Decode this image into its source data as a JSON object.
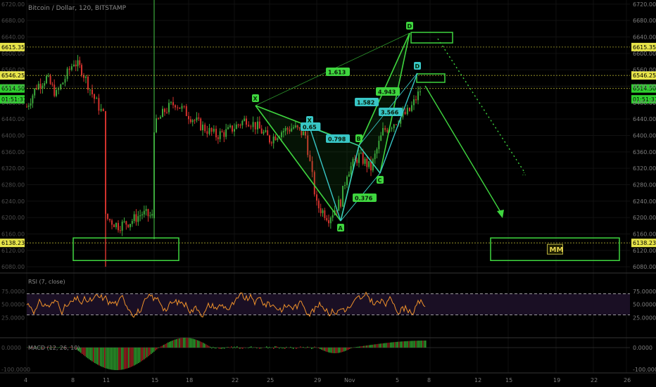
{
  "header": {
    "title": "Bitcoin / Dollar, 120, BITSTAMP"
  },
  "colors": {
    "background": "#000000",
    "up_candle": "#3ca83c",
    "down_candle": "#d2322d",
    "pattern_green": "#3fd63f",
    "pattern_cyan": "#38c6c6",
    "level_line": "#d4cf3a",
    "rsi_line": "#f0922b",
    "rsi_band": "#1a0f24",
    "price_marker_yellow": "#e8e54a",
    "price_marker_green": "#2fd02f"
  },
  "price_axis": {
    "ticks": [
      "6720.00",
      "6680.00",
      "6640.00",
      "6600.00",
      "6560.00",
      "6520.00",
      "6480.00",
      "6440.00",
      "6400.00",
      "6360.00",
      "6320.00",
      "6280.00",
      "6240.00",
      "6200.00",
      "6160.00",
      "6120.00",
      "6080.00"
    ],
    "price_markers_left": [
      {
        "text": "6615.35",
        "price": 6615.35,
        "color": "yellow"
      },
      {
        "text": "6546.25",
        "price": 6546.25,
        "color": "yellow"
      },
      {
        "text": "6514.50",
        "price": 6514.5,
        "color": "green"
      },
      {
        "text": "01:51:37",
        "price": 6488,
        "color": "green"
      },
      {
        "text": "6138.23",
        "price": 6138.23,
        "color": "yellow"
      }
    ],
    "price_markers_right": [
      {
        "text": "6615.35",
        "price": 6615.35,
        "color": "yellow"
      },
      {
        "text": "6546.25",
        "price": 6546.25,
        "color": "yellow"
      },
      {
        "text": "6514.50",
        "price": 6514.5,
        "color": "green"
      },
      {
        "text": "01:51:37",
        "price": 6488,
        "color": "green"
      },
      {
        "text": "6138.23",
        "price": 6138.23,
        "color": "yellow"
      }
    ]
  },
  "time_axis": {
    "ticks": [
      "4",
      "8",
      "11",
      "15",
      "18",
      "22",
      "25",
      "29",
      "Nov",
      "5",
      "8",
      "12",
      "15",
      "19",
      "22",
      "26"
    ]
  },
  "rsi": {
    "label": "RSI (7, close)",
    "ticks": [
      "75.0000",
      "50.0000",
      "25.0000"
    ],
    "upper": 70,
    "lower": 30
  },
  "macd": {
    "label": "MACD (12, 26, 10)",
    "ticks": [
      "0.0000",
      "-100.0000"
    ]
  },
  "chart_data": {
    "type": "candlestick",
    "title": "Bitcoin / Dollar, 120, BITSTAMP",
    "ylim": [
      6070,
      6730
    ],
    "horizontal_levels": [
      6615.35,
      6546.25,
      6514.5,
      6138.23
    ],
    "price_path": [
      [
        "4",
        6470
      ],
      [
        "5",
        6520
      ],
      [
        "6",
        6540
      ],
      [
        "7",
        6500
      ],
      [
        "8",
        6580
      ],
      [
        "9",
        6560
      ],
      [
        "10",
        6490
      ],
      [
        "11",
        6440
      ],
      [
        "11",
        6200
      ],
      [
        "12",
        6180
      ],
      [
        "13",
        6190
      ],
      [
        "14",
        6210
      ],
      [
        "15",
        6200
      ],
      [
        "15",
        6420
      ],
      [
        "16",
        6460
      ],
      [
        "17",
        6480
      ],
      [
        "18",
        6450
      ],
      [
        "19",
        6420
      ],
      [
        "20",
        6400
      ],
      [
        "21",
        6410
      ],
      [
        "22",
        6420
      ],
      [
        "23",
        6440
      ],
      [
        "24",
        6420
      ],
      [
        "25",
        6390
      ],
      [
        "26",
        6410
      ],
      [
        "27",
        6420
      ],
      [
        "28",
        6400
      ],
      [
        "29",
        6230
      ],
      [
        "30",
        6200
      ],
      [
        "31",
        6240
      ],
      [
        "Nov 1",
        6310
      ],
      [
        "Nov 2",
        6350
      ],
      [
        "Nov 3",
        6320
      ],
      [
        "Nov 4",
        6410
      ],
      [
        "Nov 5",
        6440
      ],
      [
        "Nov 6",
        6460
      ],
      [
        "Nov 7",
        6510
      ]
    ],
    "patterns": [
      {
        "name": "",
        "color": "green",
        "points": [
          {
            "label": "X",
            "x": "23",
            "price": 6478
          },
          {
            "label": "A",
            "x": "31",
            "price": 6168
          },
          {
            "label": "B",
            "x": "Nov 2",
            "price": 6374
          },
          {
            "label": "C",
            "x": "Nov 4",
            "price": 6293
          },
          {
            "label": "D",
            "x": "Nov 6",
            "price": 6655
          }
        ],
        "ratios": [
          "1.613",
          "4.943",
          "0.376"
        ]
      },
      {
        "name": "",
        "color": "cyan",
        "points": [
          {
            "label": "X",
            "x": "27",
            "price": 6420
          },
          {
            "label": "A",
            "x": "31",
            "price": 6168
          },
          {
            "label": "B",
            "x": "Nov 2",
            "price": 6374
          },
          {
            "label": "C",
            "x": "Nov 4",
            "price": 6293
          },
          {
            "label": "D",
            "x": "Nov 7",
            "price": 6546
          }
        ],
        "ratios": [
          "0.65",
          "0.798",
          "1.582",
          "3.566"
        ]
      }
    ],
    "target_boxes": [
      {
        "label": "",
        "price_range": [
          6085,
          6140
        ],
        "x_range": [
          "8",
          "15"
        ]
      },
      {
        "label": "MM",
        "price_range": [
          6085,
          6140
        ],
        "x_range": [
          "22",
          "26"
        ]
      }
    ],
    "annotation_labels": [
      "X",
      "A",
      "B",
      "C",
      "D",
      "1.613",
      "4.943",
      "0.376",
      "0.65",
      "0.798",
      "1.582",
      "3.566",
      "MM"
    ]
  }
}
